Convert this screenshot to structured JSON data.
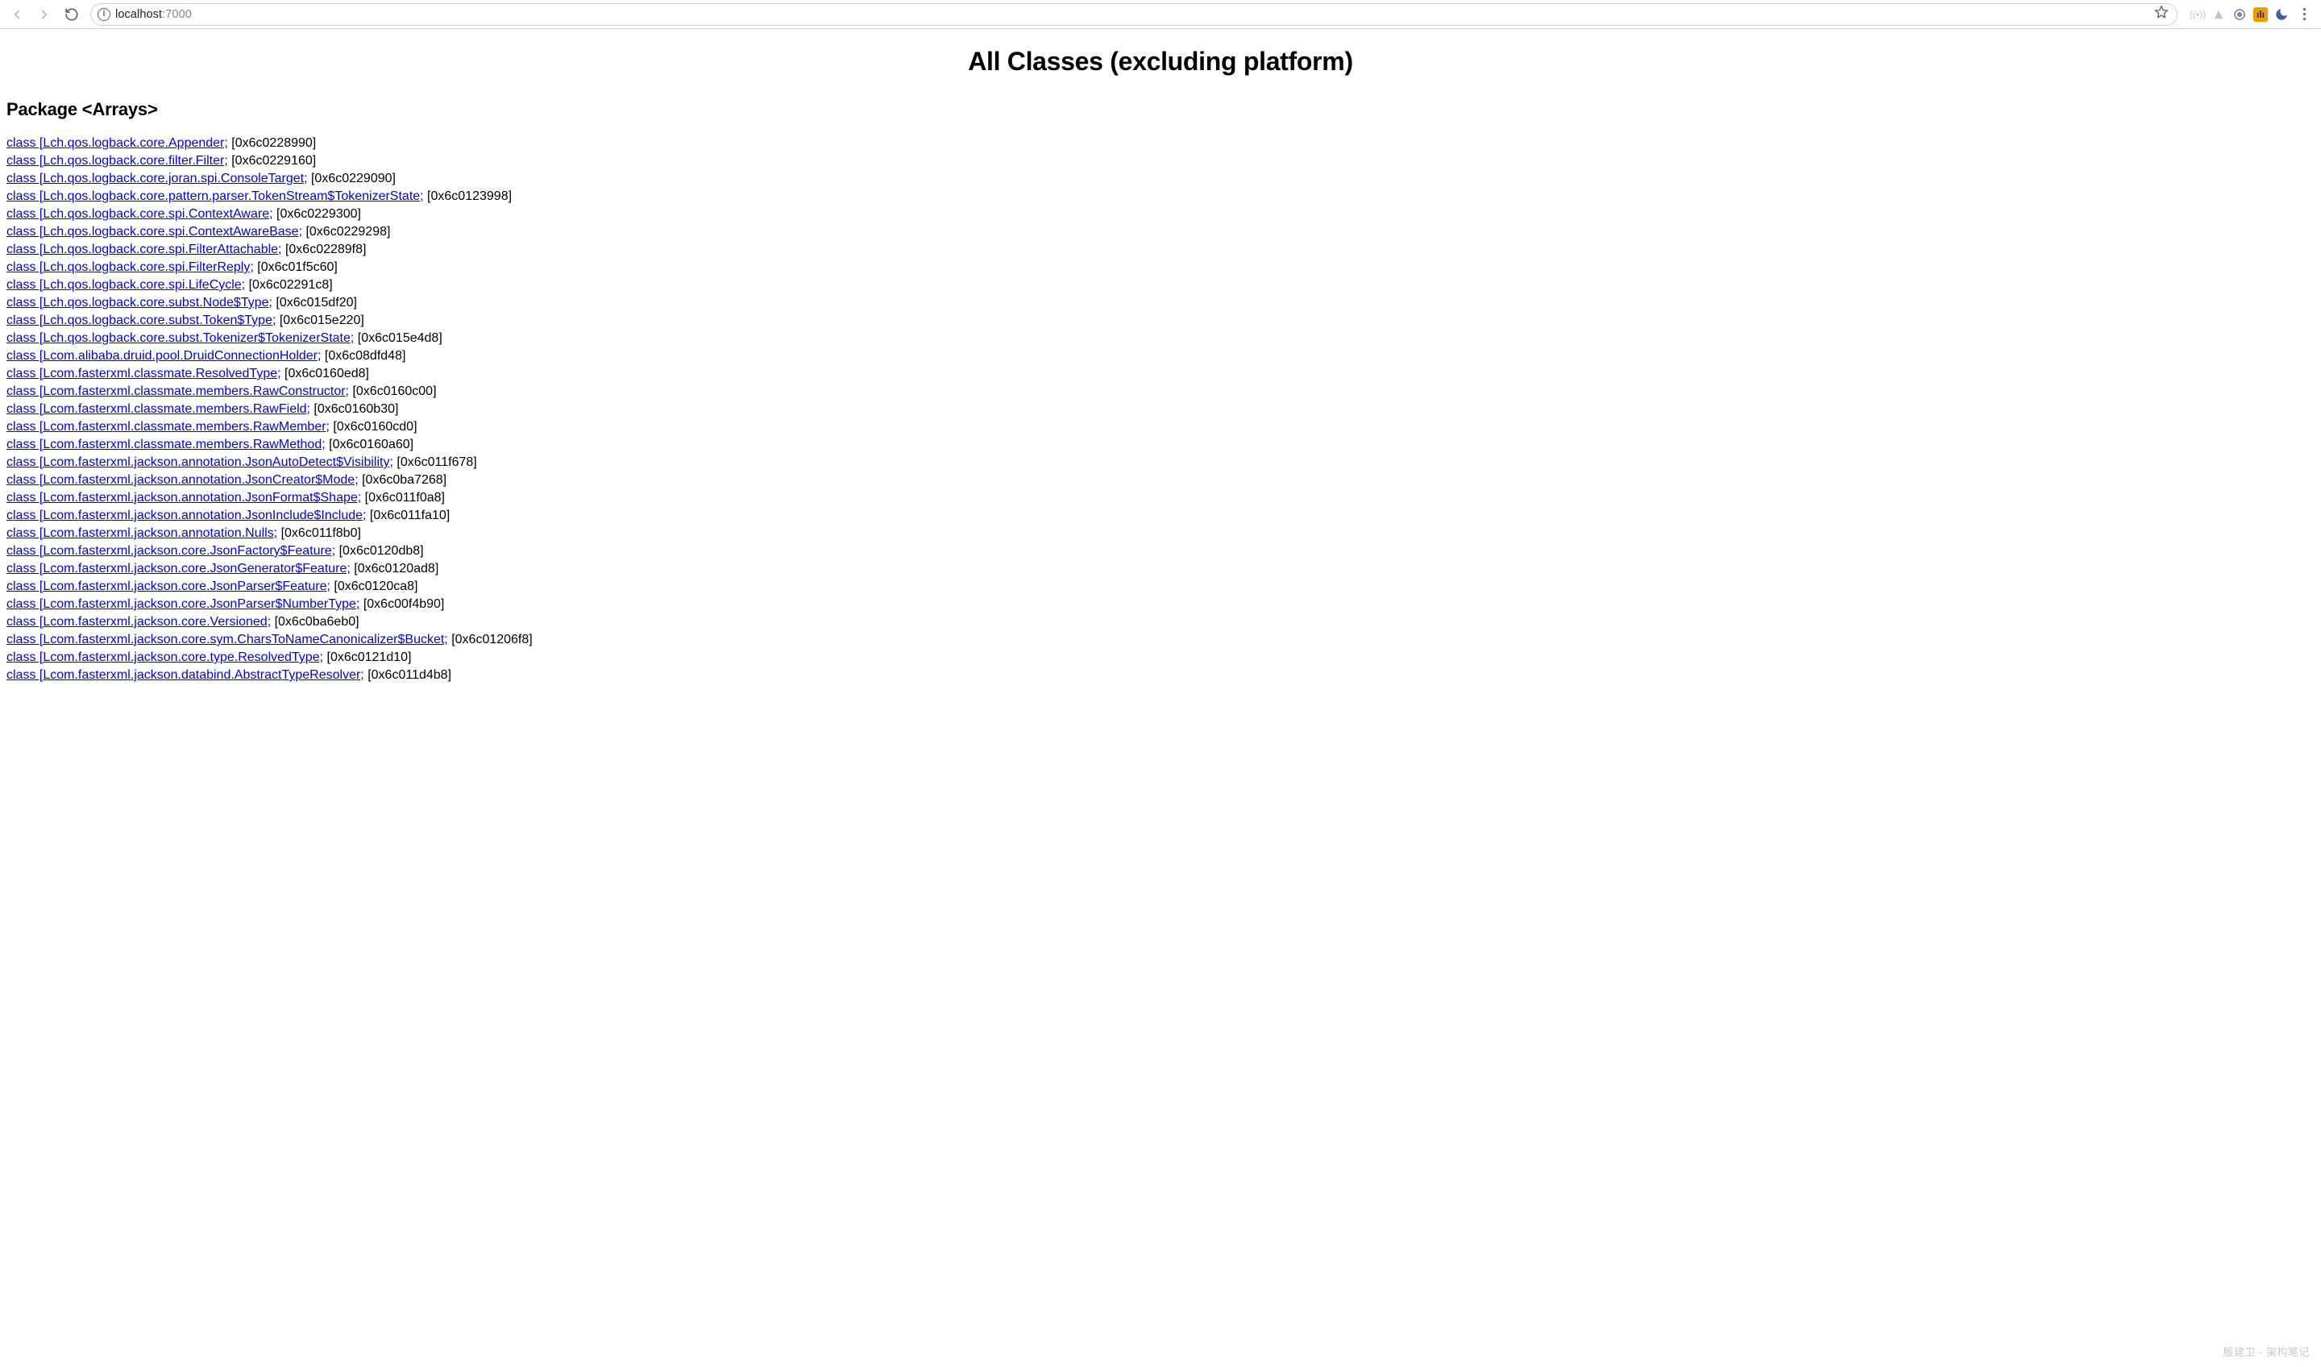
{
  "browser": {
    "url_host": "localhost",
    "url_port": ":7000"
  },
  "page": {
    "title": "All Classes (excluding platform)",
    "section_title": "Package <Arrays>",
    "watermark": "殷建卫 - 架构笔记"
  },
  "classes": [
    {
      "link": "class [Lch.qos.logback.core.Appender;",
      "addr": " [0x6c0228990]"
    },
    {
      "link": "class [Lch.qos.logback.core.filter.Filter;",
      "addr": " [0x6c0229160]"
    },
    {
      "link": "class [Lch.qos.logback.core.joran.spi.ConsoleTarget;",
      "addr": " [0x6c0229090]"
    },
    {
      "link": "class [Lch.qos.logback.core.pattern.parser.TokenStream$TokenizerState;",
      "addr": " [0x6c0123998]"
    },
    {
      "link": "class [Lch.qos.logback.core.spi.ContextAware;",
      "addr": " [0x6c0229300]"
    },
    {
      "link": "class [Lch.qos.logback.core.spi.ContextAwareBase;",
      "addr": " [0x6c0229298]"
    },
    {
      "link": "class [Lch.qos.logback.core.spi.FilterAttachable;",
      "addr": " [0x6c02289f8]"
    },
    {
      "link": "class [Lch.qos.logback.core.spi.FilterReply;",
      "addr": " [0x6c01f5c60]"
    },
    {
      "link": "class [Lch.qos.logback.core.spi.LifeCycle;",
      "addr": " [0x6c02291c8]"
    },
    {
      "link": "class [Lch.qos.logback.core.subst.Node$Type;",
      "addr": " [0x6c015df20]"
    },
    {
      "link": "class [Lch.qos.logback.core.subst.Token$Type;",
      "addr": " [0x6c015e220]"
    },
    {
      "link": "class [Lch.qos.logback.core.subst.Tokenizer$TokenizerState;",
      "addr": " [0x6c015e4d8]"
    },
    {
      "link": "class [Lcom.alibaba.druid.pool.DruidConnectionHolder;",
      "addr": " [0x6c08dfd48]"
    },
    {
      "link": "class [Lcom.fasterxml.classmate.ResolvedType;",
      "addr": " [0x6c0160ed8]"
    },
    {
      "link": "class [Lcom.fasterxml.classmate.members.RawConstructor;",
      "addr": " [0x6c0160c00]"
    },
    {
      "link": "class [Lcom.fasterxml.classmate.members.RawField;",
      "addr": " [0x6c0160b30]"
    },
    {
      "link": "class [Lcom.fasterxml.classmate.members.RawMember;",
      "addr": " [0x6c0160cd0]"
    },
    {
      "link": "class [Lcom.fasterxml.classmate.members.RawMethod;",
      "addr": " [0x6c0160a60]"
    },
    {
      "link": "class [Lcom.fasterxml.jackson.annotation.JsonAutoDetect$Visibility;",
      "addr": " [0x6c011f678]"
    },
    {
      "link": "class [Lcom.fasterxml.jackson.annotation.JsonCreator$Mode;",
      "addr": " [0x6c0ba7268]"
    },
    {
      "link": "class [Lcom.fasterxml.jackson.annotation.JsonFormat$Shape;",
      "addr": " [0x6c011f0a8]"
    },
    {
      "link": "class [Lcom.fasterxml.jackson.annotation.JsonInclude$Include;",
      "addr": " [0x6c011fa10]"
    },
    {
      "link": "class [Lcom.fasterxml.jackson.annotation.Nulls;",
      "addr": " [0x6c011f8b0]"
    },
    {
      "link": "class [Lcom.fasterxml.jackson.core.JsonFactory$Feature;",
      "addr": " [0x6c0120db8]"
    },
    {
      "link": "class [Lcom.fasterxml.jackson.core.JsonGenerator$Feature;",
      "addr": " [0x6c0120ad8]"
    },
    {
      "link": "class [Lcom.fasterxml.jackson.core.JsonParser$Feature;",
      "addr": " [0x6c0120ca8]"
    },
    {
      "link": "class [Lcom.fasterxml.jackson.core.JsonParser$NumberType;",
      "addr": " [0x6c00f4b90]"
    },
    {
      "link": "class [Lcom.fasterxml.jackson.core.Versioned;",
      "addr": " [0x6c0ba6eb0]"
    },
    {
      "link": "class [Lcom.fasterxml.jackson.core.sym.CharsToNameCanonicalizer$Bucket;",
      "addr": " [0x6c01206f8]"
    },
    {
      "link": "class [Lcom.fasterxml.jackson.core.type.ResolvedType;",
      "addr": " [0x6c0121d10]"
    },
    {
      "link": "class [Lcom.fasterxml.jackson.databind.AbstractTypeResolver;",
      "addr": " [0x6c011d4b8]"
    }
  ]
}
